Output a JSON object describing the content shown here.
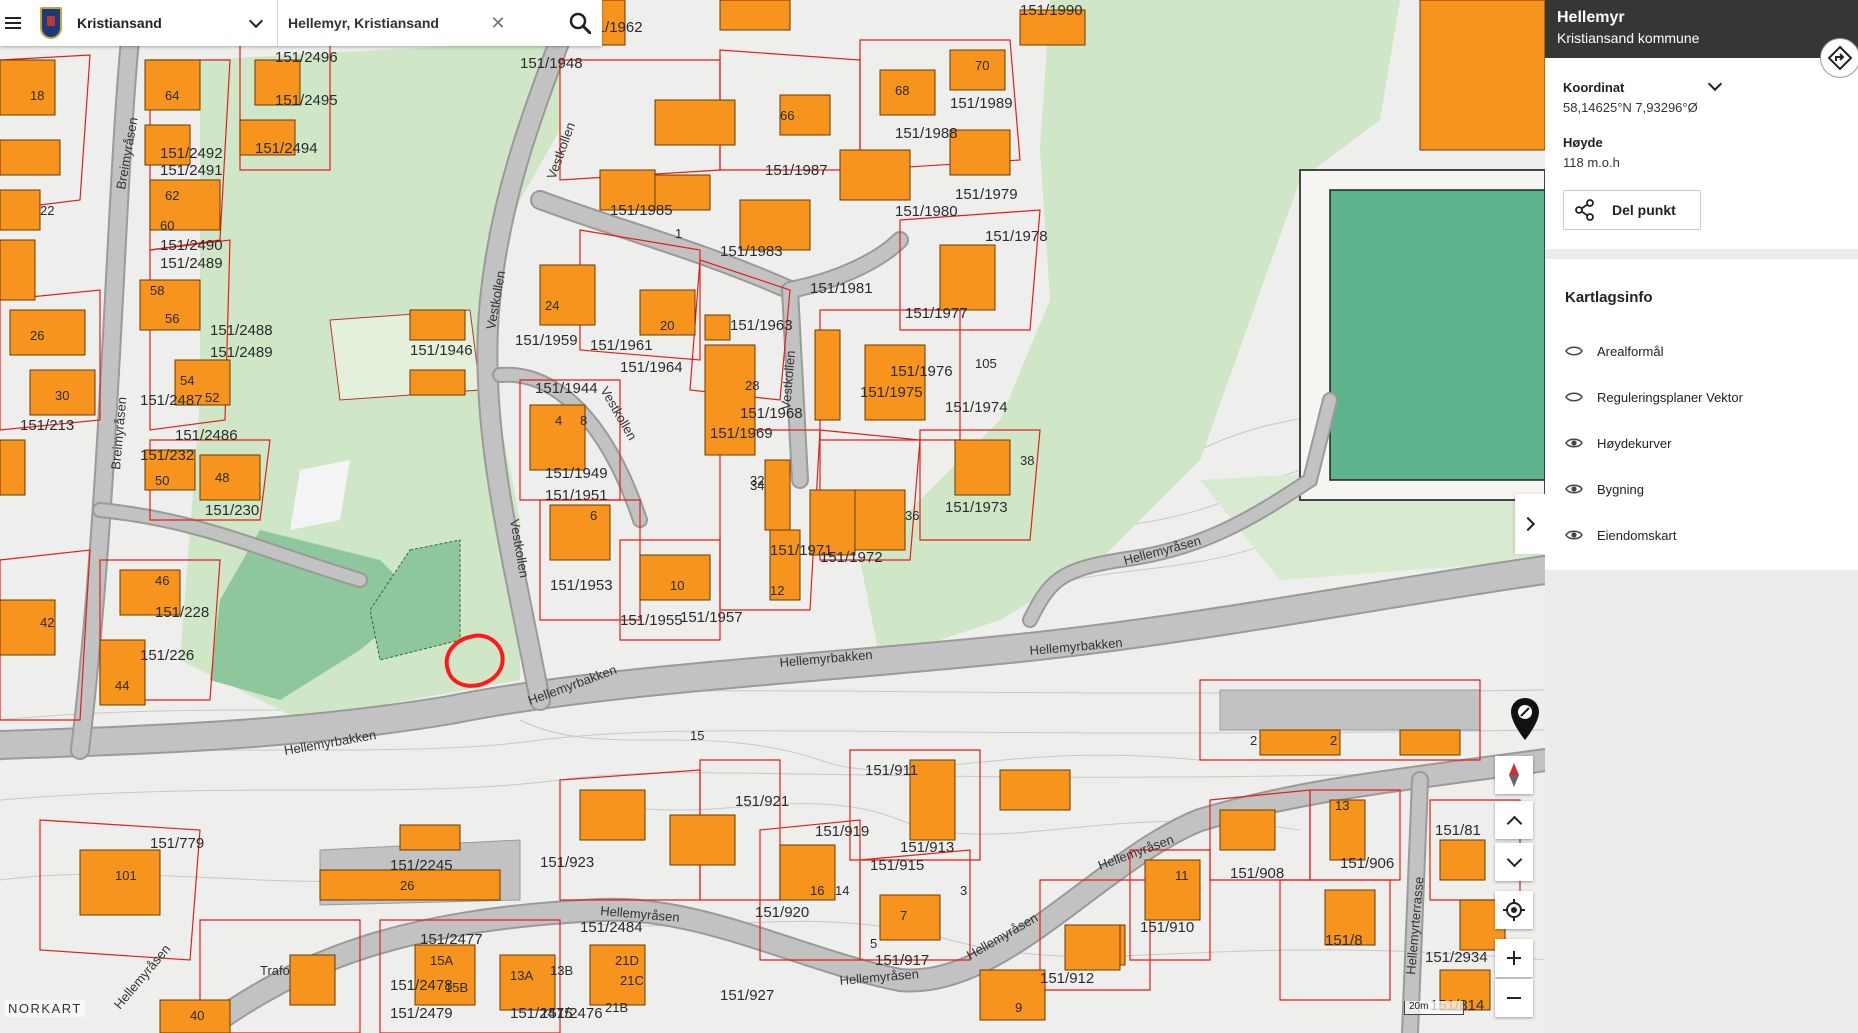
{
  "search": {
    "municipality": "Kristiansand",
    "query": "Hellemyr, Kristiansand",
    "clear_glyph": "✕"
  },
  "panel": {
    "title": "Hellemyr",
    "subtitle": "Kristiansand kommune",
    "coord_label": "Koordinat",
    "coord_value": "58,14625°N 7,93296°Ø",
    "height_label": "Høyde",
    "height_value": "118 m.o.h",
    "share_label": "Del punkt",
    "layers_title": "Kartlagsinfo",
    "layers": [
      {
        "name": "Arealformål",
        "visible": false
      },
      {
        "name": "Reguleringsplaner Vektor",
        "visible": false
      },
      {
        "name": "Høydekurver",
        "visible": true
      },
      {
        "name": "Bygning",
        "visible": true
      },
      {
        "name": "Eiendomskart",
        "visible": true
      }
    ]
  },
  "map": {
    "logo": "NORKART",
    "scale": "20m",
    "colors": {
      "building": "#f7941d",
      "parcel": "#e0201b",
      "road": "#b8b8b8",
      "green": "#cfe7c6",
      "field": "#8dc79b",
      "sportsfield": "#5db38b",
      "marker": "#111111",
      "circle": "#ff1a1a"
    },
    "road_names": [
      "Vestkollen",
      "Vestkollen",
      "Vestkollen",
      "Vestkollen",
      "Vestkollen",
      "Hellemyrbakken",
      "Hellemyrbakken",
      "Hellemyrbakken",
      "Hellemyrbakken",
      "Hellemyråsen",
      "Hellemyråsen",
      "Hellemyråsen",
      "Hellemyråsen",
      "Hellemyråsen",
      "Breimyråsen",
      "Breimyråsen",
      "Hellemyrterrasse",
      "Hellemyråsen",
      "Trafo"
    ],
    "parcel_labels": [
      "151/1962",
      "151/1990",
      "151/1948",
      "151/2496",
      "151/2495",
      "151/2494",
      "151/2492",
      "151/2491",
      "151/2490",
      "151/2489",
      "151/2488",
      "151/2489",
      "151/2487",
      "151/2486",
      "151/232",
      "151/230",
      "151/213",
      "151/228",
      "151/226",
      "151/1946",
      "151/1959",
      "151/1961",
      "151/1964",
      "151/1963",
      "151/1968",
      "151/1969",
      "151/1949",
      "151/1951",
      "151/1953",
      "151/1955",
      "151/1957",
      "151/1971",
      "151/1972",
      "151/1973",
      "151/1974",
      "151/1975",
      "151/1976",
      "151/1977",
      "151/1978",
      "151/1979",
      "151/1980",
      "151/1981",
      "151/1983",
      "151/1985",
      "151/1987",
      "151/1988",
      "151/1989",
      "151/1944",
      "151/779",
      "151/2245",
      "151/2484",
      "151/2477",
      "151/2478",
      "151/2479",
      "151/2475",
      "151/2476",
      "151/927",
      "151/923",
      "151/921",
      "151/919",
      "151/920",
      "151/917",
      "151/915",
      "151/913",
      "151/911",
      "151/912",
      "151/910",
      "151/908",
      "151/906",
      "151/8",
      "151/814",
      "151/2934",
      "151/81"
    ],
    "house_numbers": [
      "18",
      "64",
      "62",
      "60",
      "58",
      "56",
      "54",
      "52",
      "50",
      "48",
      "46",
      "44",
      "42",
      "40",
      "38",
      "36",
      "34",
      "32",
      "30",
      "28",
      "26",
      "24",
      "22",
      "20",
      "16",
      "14",
      "12",
      "10",
      "8",
      "6",
      "4",
      "2",
      "70",
      "68",
      "66",
      "105",
      "1",
      "15",
      "13",
      "11",
      "9",
      "7",
      "5",
      "3",
      "13A",
      "13B",
      "15A",
      "15B",
      "21B",
      "21C",
      "21D",
      "2",
      "101",
      "26"
    ]
  }
}
